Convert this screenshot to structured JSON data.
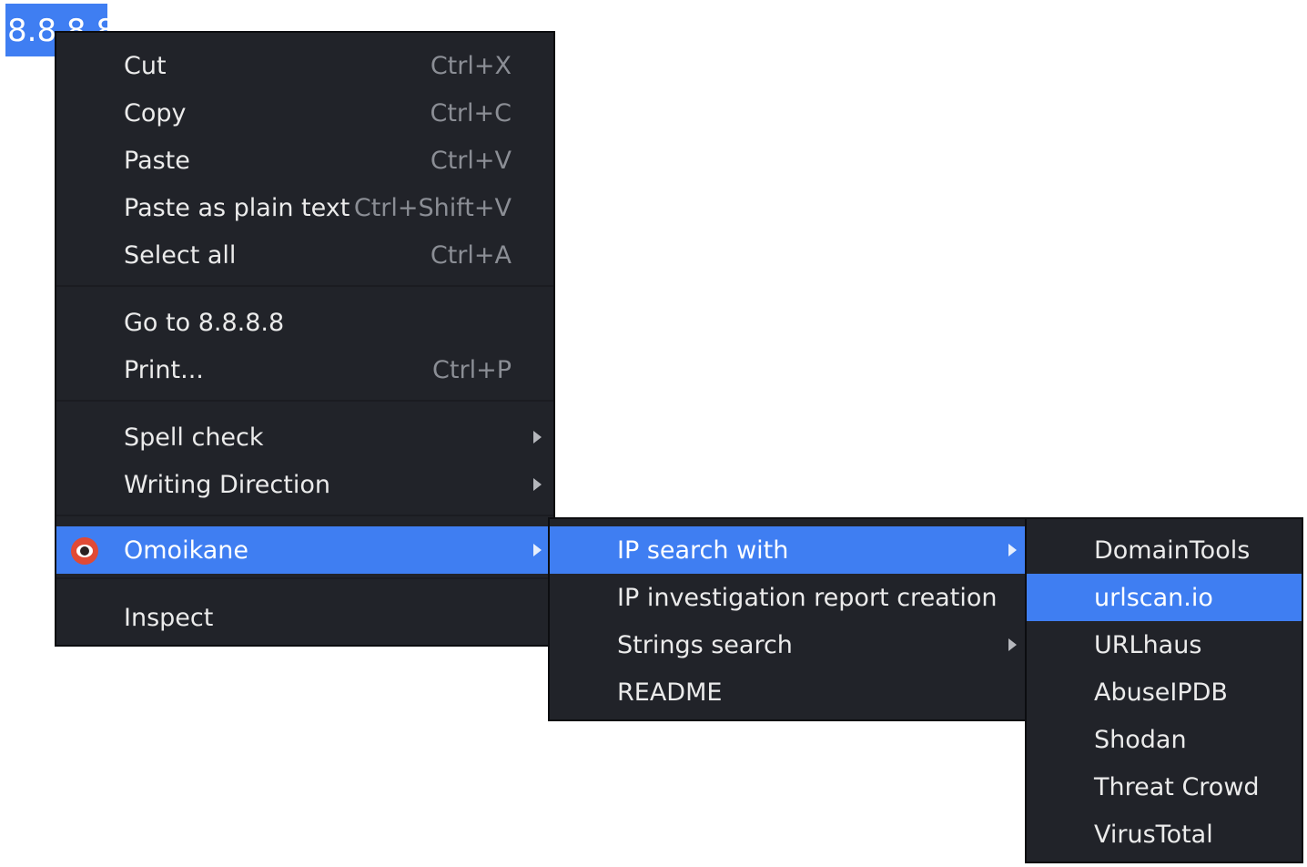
{
  "selected_text": "8.8.8.8",
  "context_menu": {
    "cut": {
      "label": "Cut",
      "shortcut": "Ctrl+X"
    },
    "copy": {
      "label": "Copy",
      "shortcut": "Ctrl+C"
    },
    "paste": {
      "label": "Paste",
      "shortcut": "Ctrl+V"
    },
    "paste_plain": {
      "label": "Paste as plain text",
      "shortcut": "Ctrl+Shift+V"
    },
    "select_all": {
      "label": "Select all",
      "shortcut": "Ctrl+A"
    },
    "go_to": {
      "label": "Go to 8.8.8.8"
    },
    "print": {
      "label": "Print...",
      "shortcut": "Ctrl+P"
    },
    "spell_check": {
      "label": "Spell check"
    },
    "writing_direction": {
      "label": "Writing Direction"
    },
    "omoikane": {
      "label": "Omoikane",
      "icon": "omoikane-eye-icon"
    },
    "inspect": {
      "label": "Inspect"
    }
  },
  "omoikane_menu": {
    "ip_search": {
      "label": "IP search with"
    },
    "ip_report": {
      "label": "IP investigation report creation"
    },
    "strings_search": {
      "label": "Strings search"
    },
    "readme": {
      "label": "README"
    }
  },
  "ip_search_menu": {
    "items": [
      "DomainTools",
      "urlscan.io",
      "URLhaus",
      "AbuseIPDB",
      "Shodan",
      "Threat Crowd",
      "VirusTotal"
    ],
    "highlighted": "urlscan.io"
  },
  "colors": {
    "menu_bg": "#212329",
    "highlight": "#3f7ef2",
    "text": "#ebebeb",
    "shortcut": "#8b8e95"
  }
}
